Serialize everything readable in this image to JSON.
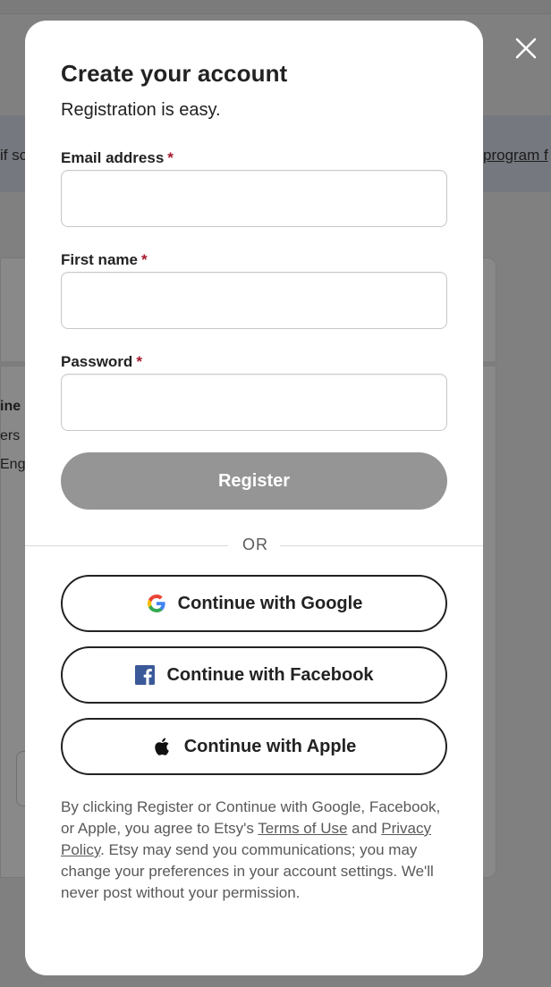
{
  "background": {
    "banner_left_text": "if sc",
    "banner_right_text": "program f",
    "card_lines": [
      "ine",
      "ers",
      "Eng"
    ]
  },
  "modal": {
    "title": "Create your account",
    "subtitle": "Registration is easy.",
    "fields": {
      "email": {
        "label": "Email address",
        "required_mark": "*",
        "value": ""
      },
      "first_name": {
        "label": "First name",
        "required_mark": "*",
        "value": ""
      },
      "password": {
        "label": "Password",
        "required_mark": "*",
        "value": ""
      }
    },
    "register_label": "Register",
    "divider_text": "OR",
    "social": {
      "google_label": "Continue with Google",
      "facebook_label": "Continue with Facebook",
      "apple_label": "Continue with Apple"
    },
    "legal": {
      "part1": "By clicking Register or Continue with Google, Facebook, or Apple, you agree to Etsy's ",
      "terms_link": "Terms of Use",
      "part2": " and ",
      "privacy_link": "Privacy Policy",
      "part3": ". Etsy may send you communications; you may change your preferences in your account settings. We'll never post without your permission."
    }
  },
  "icons": {
    "close": "close-icon",
    "google": "google-icon",
    "facebook": "facebook-icon",
    "apple": "apple-icon"
  },
  "colors": {
    "required": "#a61a2e",
    "register_disabled": "#959595",
    "overlay": "#858585",
    "facebook_blue": "#3b5998"
  }
}
